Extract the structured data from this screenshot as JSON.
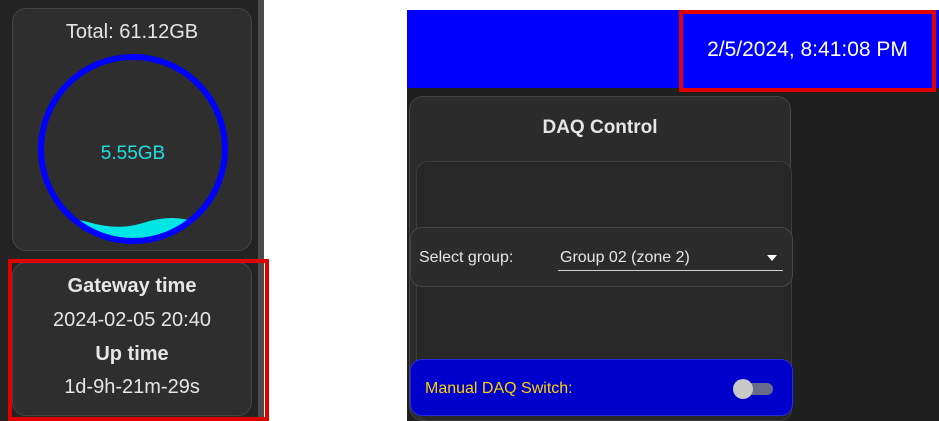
{
  "storage": {
    "total_label": "Total: 61.12GB",
    "used_label": "5.55GB",
    "used_fraction": 0.09
  },
  "gateway": {
    "gateway_time_heading": "Gateway time",
    "gateway_time_value": "2024-02-05 20:40",
    "uptime_heading": "Up time",
    "uptime_value": "1d-9h-21m-29s"
  },
  "header": {
    "datetime": "2/5/2024, 8:41:08 PM"
  },
  "daq": {
    "title": "DAQ Control",
    "select_group_label": "Select group:",
    "selected_group": "Group 02 (zone 2)",
    "manual_switch_label": "Manual DAQ Switch:",
    "manual_switch_on": false
  },
  "colors": {
    "header_blue": "#0000ff",
    "highlight_red": "#e00000",
    "gauge_ring": "#0000ff",
    "gauge_fill": "#00e5e5",
    "manual_label": "#ffd200"
  },
  "icons": {
    "dropdown": "caret-down-icon",
    "switch": "toggle-switch"
  }
}
